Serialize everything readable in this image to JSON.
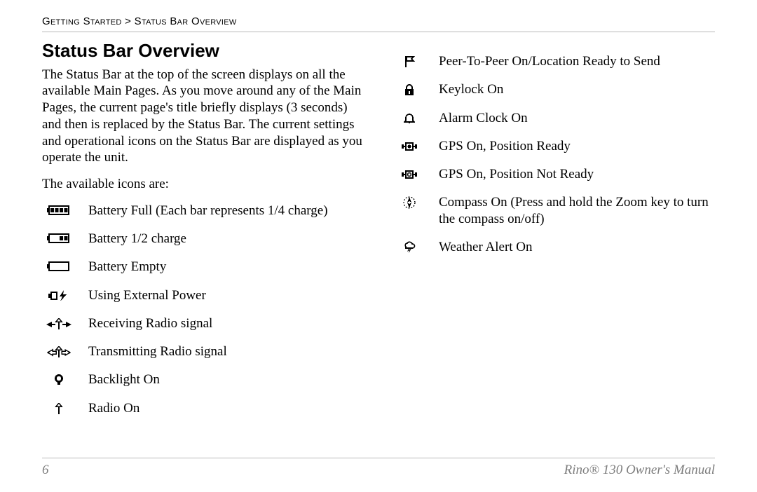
{
  "breadcrumb": {
    "section": "Getting Started",
    "sep": ">",
    "page": "Status Bar Overview"
  },
  "heading": "Status Bar Overview",
  "intro": "The Status Bar at the top of the screen displays on all the available Main Pages. As you move around any of the Main Pages, the current page's title briefly displays (3 seconds) and then is replaced by the Status Bar. The current settings and operational icons on the Status Bar are displayed as you operate the unit.",
  "lead": "The available icons are:",
  "left_icons": [
    {
      "id": "battery-full",
      "label": "Battery Full (Each bar represents 1/4 charge)"
    },
    {
      "id": "battery-half",
      "label": "Battery 1/2 charge"
    },
    {
      "id": "battery-empty",
      "label": "Battery Empty"
    },
    {
      "id": "external-power",
      "label": "Using External Power"
    },
    {
      "id": "radio-rx",
      "label": "Receiving Radio signal"
    },
    {
      "id": "radio-tx",
      "label": "Transmitting Radio signal"
    },
    {
      "id": "backlight",
      "label": "Backlight On"
    },
    {
      "id": "radio-on",
      "label": "Radio On"
    }
  ],
  "right_icons": [
    {
      "id": "flag",
      "label": "Peer-To-Peer On/Location Ready to Send"
    },
    {
      "id": "keylock",
      "label": "Keylock On"
    },
    {
      "id": "alarm",
      "label": "Alarm Clock On"
    },
    {
      "id": "gps-ready",
      "label": "GPS On, Position Ready"
    },
    {
      "id": "gps-notready",
      "label": "GPS On, Position Not Ready"
    },
    {
      "id": "compass",
      "label": "Compass On (Press and hold the Zoom key to turn the compass on/off)"
    },
    {
      "id": "weather",
      "label": "Weather Alert On"
    }
  ],
  "footer": {
    "pagenum": "6",
    "booktitle": "Rino® 130 Owner's Manual"
  }
}
